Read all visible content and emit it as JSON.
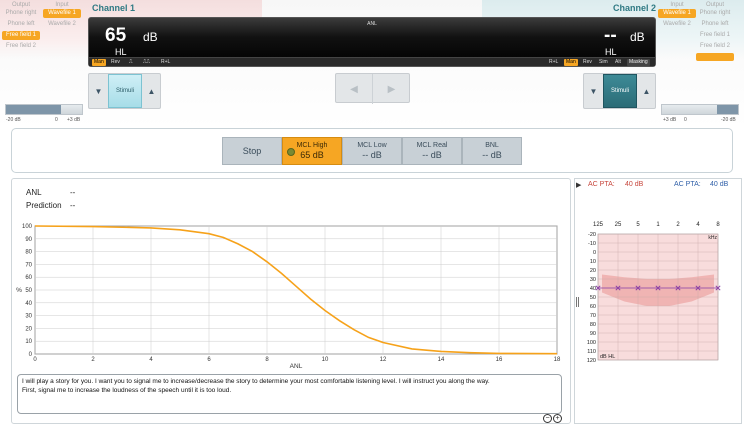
{
  "routing": {
    "left": {
      "output_header": "Output",
      "input_header": "Input",
      "outputs": [
        "Phone right",
        "Phone left",
        "Free field 1",
        "Free field 2"
      ],
      "inputs": [
        "Wavefile 1",
        "Wavefile 2"
      ],
      "selected_output": "Free field 1",
      "selected_input": "Wavefile 1"
    },
    "right": {
      "input_header": "Input",
      "output_header": "Output",
      "inputs": [
        "Wavefile 1",
        "Wavefile 2"
      ],
      "outputs": [
        "Phone right",
        "Phone left",
        "Free field 1",
        "Free field 2"
      ],
      "selected_input": "Wavefile 1",
      "selected_output": "Free field 2"
    }
  },
  "channel1": {
    "title": "Channel 1",
    "level": "65",
    "unit": "dB",
    "transducer": "HL",
    "modes": [
      "Man",
      "Rev",
      "⎍",
      "⎍⎍",
      "R+L"
    ],
    "active_mode": "Man",
    "stimuli_label": "Stimuli",
    "level_ticks": [
      "-20 dB",
      "0",
      "+3 dB"
    ],
    "level_fraction": 0.72
  },
  "channel2": {
    "title": "Channel 2",
    "level": "--",
    "unit": "dB",
    "transducer": "HL",
    "modes": [
      "R+L",
      "Man",
      "Rev",
      "Sim",
      "Alt",
      "Masking"
    ],
    "active_mode": "Man",
    "stimuli_label": "Stimuli",
    "level_ticks": [
      "+3 dB",
      "0",
      "-20 dB"
    ],
    "level_fraction": 0.28
  },
  "display": {
    "test_name": "ANL"
  },
  "mcl_buttons": [
    {
      "id": "stop",
      "label": "Stop",
      "value": ""
    },
    {
      "id": "mcl-high",
      "label": "MCL High",
      "value": "65 dB",
      "selected": true
    },
    {
      "id": "mcl-low",
      "label": "MCL Low",
      "value": "-- dB"
    },
    {
      "id": "mcl-real",
      "label": "MCL Real",
      "value": "-- dB"
    },
    {
      "id": "bnl",
      "label": "BNL",
      "value": "-- dB"
    }
  ],
  "anl_summary": {
    "anl_label": "ANL",
    "anl_value": "--",
    "prediction_label": "Prediction",
    "prediction_value": "--"
  },
  "chart_data": {
    "type": "line",
    "xlabel": "ANL",
    "ylabel": "%",
    "xlim": [
      0,
      18
    ],
    "ylim": [
      0,
      100
    ],
    "x_ticks": [
      0,
      2,
      4,
      6,
      8,
      10,
      12,
      14,
      16,
      18
    ],
    "y_ticks": [
      0,
      10,
      20,
      30,
      40,
      50,
      60,
      70,
      80,
      90,
      100
    ],
    "grid": true,
    "line_color": "#f6a21a",
    "series": [
      {
        "x": [
          0,
          2,
          4,
          5,
          6,
          6.5,
          7,
          7.5,
          8,
          8.5,
          9,
          9.5,
          10,
          10.5,
          11,
          11.5,
          12,
          13,
          14,
          15,
          16,
          18
        ],
        "y": [
          100,
          99.5,
          98.5,
          97,
          94,
          91,
          86,
          80,
          72,
          63,
          53,
          43,
          34,
          26,
          19,
          13,
          9,
          4,
          2,
          1,
          0.5,
          0.2
        ]
      }
    ]
  },
  "instructions": "I will play a story for you. I want you to signal me to increase/decrease the story to determine your most comfortable listening level. I will instruct you along the way.\nFirst, signal me to increase the loudness of the speech until it is too loud.",
  "notes_controls": {
    "minus": "−",
    "plus": "+"
  },
  "audiogram": {
    "ac_pta_left_label": "AC PTA:",
    "ac_pta_left_value": "40 dB",
    "ac_pta_right_label": "AC PTA:",
    "ac_pta_right_value": "40 dB",
    "freq_labels": [
      "125",
      "25",
      "5",
      "1",
      "2",
      "4",
      "8"
    ],
    "freq_unit": "kHz",
    "db_ticks": [
      "-20",
      "-10",
      "0",
      "10",
      "20",
      "30",
      "40",
      "50",
      "60",
      "70",
      "80",
      "90",
      "100",
      "110",
      "120"
    ],
    "db_unit": "dB HL",
    "symbol_level_db": 40,
    "speech_banana_top_db": [
      25,
      28,
      30,
      30,
      28,
      25
    ],
    "speech_banana_bottom_db": [
      45,
      55,
      60,
      60,
      55,
      45
    ],
    "background_color": "#f8dcdc",
    "banana_color": "#eeaaa9",
    "symbol_color": "#8a3ea6"
  }
}
